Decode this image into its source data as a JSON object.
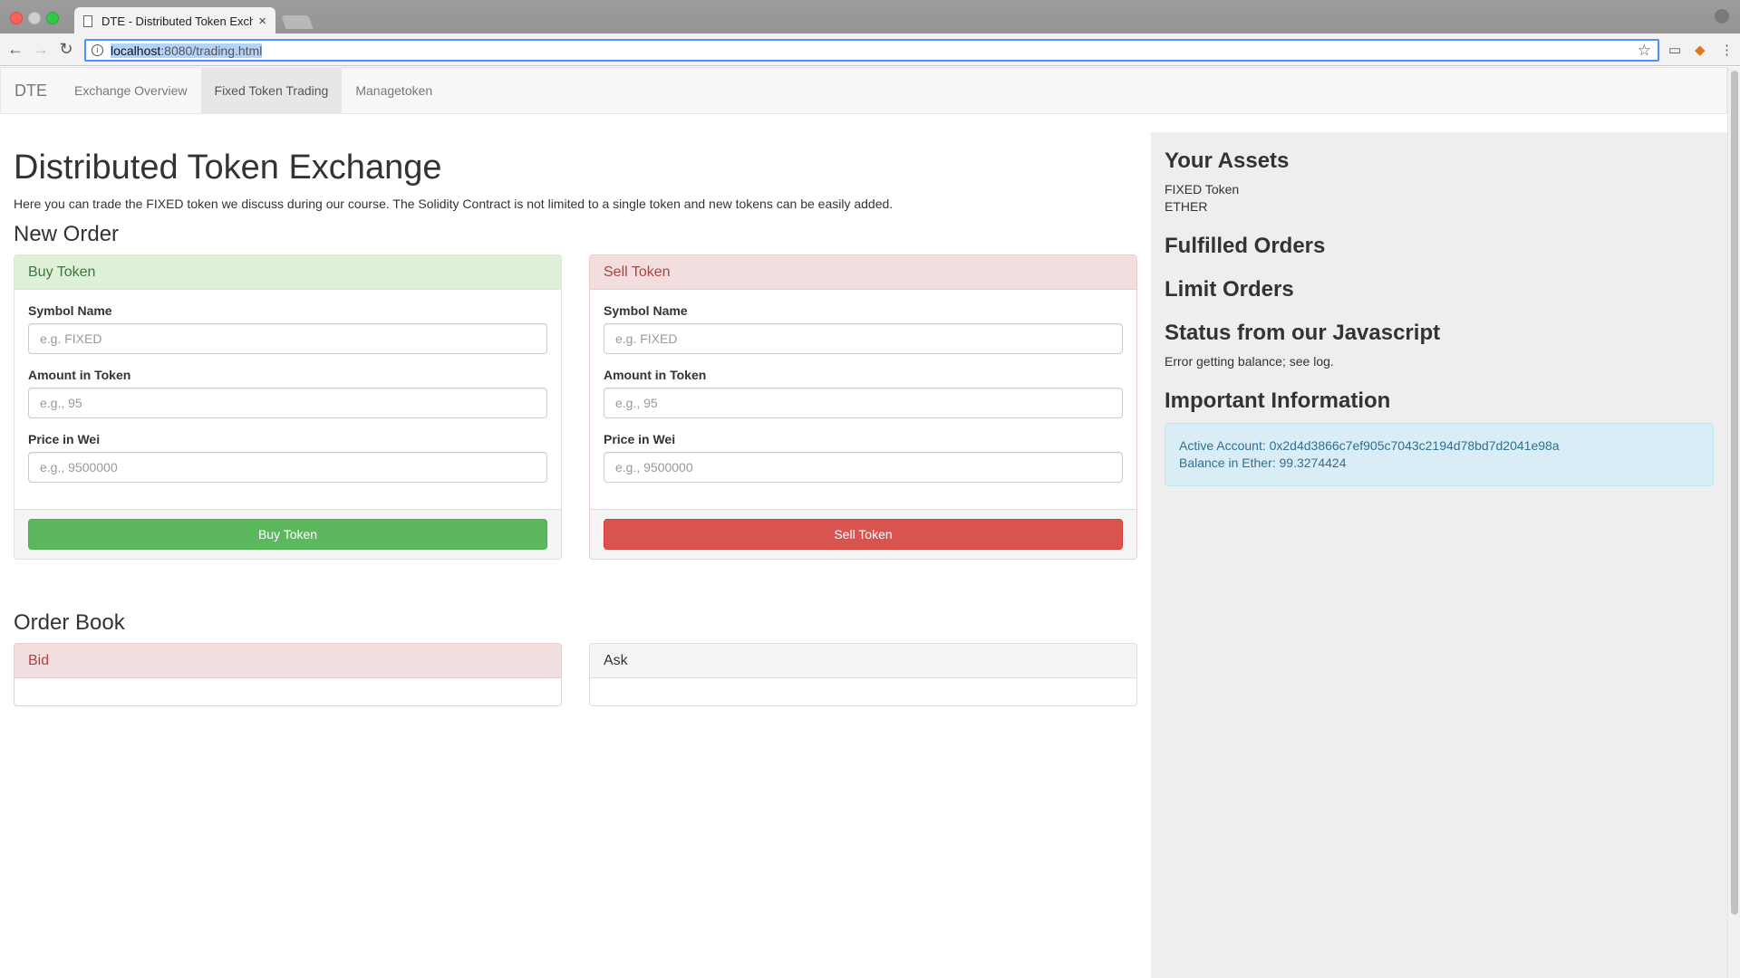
{
  "browser": {
    "tab_title": "DTE - Distributed Token Exchange",
    "tab_close": "×",
    "url_host": "localhost",
    "url_path": ":8080/trading.html"
  },
  "navbar": {
    "brand": "DTE",
    "links": [
      "Exchange Overview",
      "Fixed Token Trading",
      "Managetoken"
    ],
    "active_index": 1
  },
  "main": {
    "title": "Distributed Token Exchange",
    "intro": "Here you can trade the FIXED token we discuss during our course. The Solidity Contract is not limited to a single token and new tokens can be easily added.",
    "new_order_heading": "New Order",
    "buy": {
      "heading": "Buy Token",
      "symbol_label": "Symbol Name",
      "symbol_placeholder": "e.g. FIXED",
      "amount_label": "Amount in Token",
      "amount_placeholder": "e.g., 95",
      "price_label": "Price in Wei",
      "price_placeholder": "e.g., 9500000",
      "button": "Buy Token"
    },
    "sell": {
      "heading": "Sell Token",
      "symbol_label": "Symbol Name",
      "symbol_placeholder": "e.g. FIXED",
      "amount_label": "Amount in Token",
      "amount_placeholder": "e.g., 95",
      "price_label": "Price in Wei",
      "price_placeholder": "e.g., 9500000",
      "button": "Sell Token"
    },
    "order_book_heading": "Order Book",
    "bid_heading": "Bid",
    "ask_heading": "Ask"
  },
  "sidebar": {
    "assets_heading": "Your Assets",
    "assets": [
      "FIXED Token",
      "ETHER"
    ],
    "fulfilled_heading": "Fulfilled Orders",
    "limit_heading": "Limit Orders",
    "status_heading": "Status from our Javascript",
    "status_text": "Error getting balance; see log.",
    "info_heading": "Important Information",
    "active_account": "Active Account: 0x2d4d3866c7ef905c7043c2194d78bd7d2041e98a",
    "balance": "Balance in Ether: 99.3274424"
  },
  "colors": {
    "buy": "#5cb85c",
    "sell": "#d9534f",
    "info_bg": "#d9edf7",
    "sidebar_bg": "#eeeeee"
  },
  "icons": [
    "close-icon",
    "document-icon",
    "back-arrow-icon",
    "forward-arrow-icon",
    "reload-icon",
    "info-icon",
    "star-icon",
    "cast-icon",
    "metamask-fox-icon",
    "menu-dots-icon",
    "profile-icon"
  ]
}
